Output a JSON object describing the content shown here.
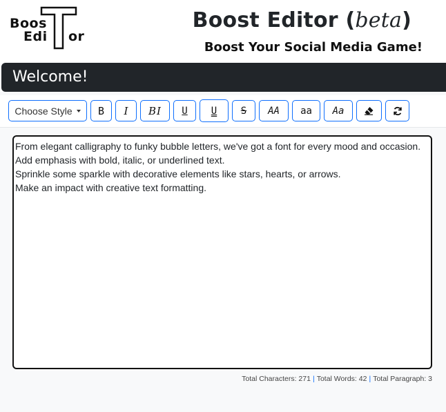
{
  "header": {
    "logo": {
      "line1": "Boos",
      "line2_left": "Edi",
      "line2_right": "or",
      "letter": "T"
    },
    "title_main": "Boost Editor",
    "title_paren_open": "(",
    "title_beta": "beta",
    "title_paren_close": ")",
    "subtitle": "Boost Your Social Media Game!"
  },
  "welcome": {
    "text": "Welcome!"
  },
  "toolbar": {
    "style_dropdown_label": "Choose Style",
    "buttons": [
      {
        "icon": "bold-icon",
        "label": "B"
      },
      {
        "icon": "italic-icon",
        "label": "I"
      },
      {
        "icon": "bold-italic-icon",
        "label": "BI"
      },
      {
        "icon": "underline-icon",
        "label": "U"
      },
      {
        "icon": "double-underline-icon",
        "label": "U"
      },
      {
        "icon": "strikethrough-icon",
        "label": "S"
      },
      {
        "icon": "uppercase-icon",
        "label": "AA"
      },
      {
        "icon": "lowercase-icon",
        "label": "aa"
      },
      {
        "icon": "titlecase-icon",
        "label": "Aa"
      },
      {
        "icon": "eraser-icon",
        "label": ""
      },
      {
        "icon": "refresh-icon",
        "label": ""
      }
    ]
  },
  "editor": {
    "lines": [
      "From elegant calligraphy to funky bubble letters, we've got a font for every mood and occasion.",
      "Add emphasis with bold, italic, or underlined text.",
      "Sprinkle some sparkle with decorative elements like stars, hearts, or arrows.",
      "Make an impact with creative text formatting."
    ]
  },
  "stats": {
    "characters_label": "Total Characters: 271",
    "words_label": "Total Words: 42",
    "paragraph_label": "Total Paragraph: 3",
    "separator": "|"
  },
  "colors": {
    "accent": "#0d6efd",
    "dark_bar": "#212529",
    "background_light": "#f8f9fa"
  }
}
